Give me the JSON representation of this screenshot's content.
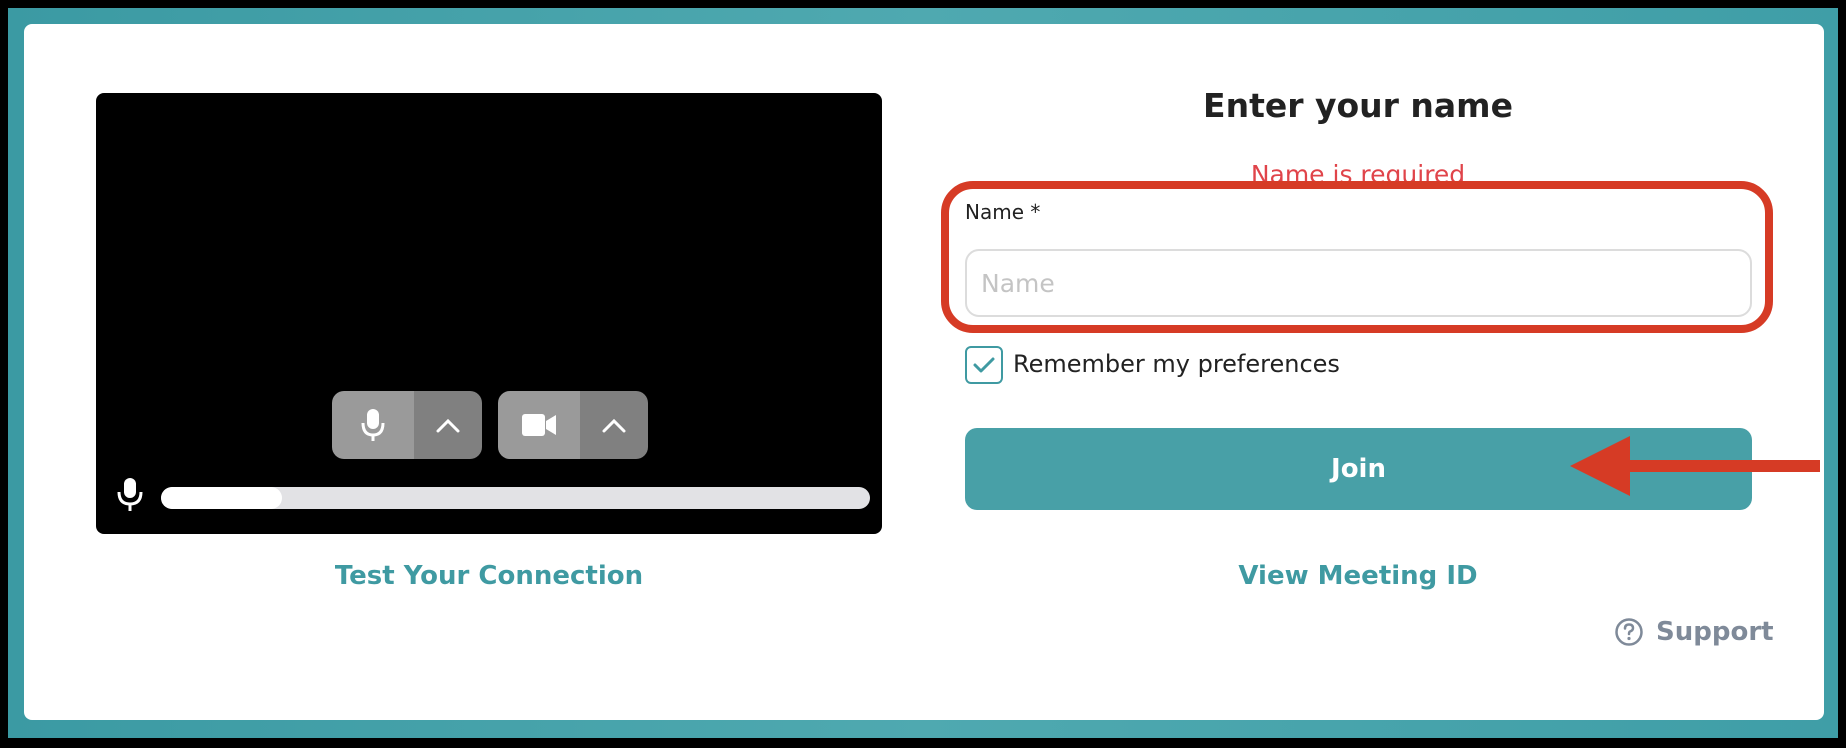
{
  "preview": {
    "mic_button": {
      "icon": "microphone-icon",
      "menu_icon": "chevron-up-icon"
    },
    "camera_button": {
      "icon": "video-camera-icon",
      "menu_icon": "chevron-up-icon"
    },
    "audio_level": 0.17,
    "test_connection_label": "Test Your Connection"
  },
  "form": {
    "heading": "Enter your name",
    "error_text": "Name is required",
    "name_label": "Name *",
    "name_placeholder": "Name",
    "name_value": "",
    "remember_label": "Remember my preferences",
    "remember_checked": true,
    "join_label": "Join",
    "meeting_id_label": "View Meeting ID"
  },
  "support": {
    "label": "Support",
    "icon": "help-circle-icon"
  },
  "colors": {
    "accent": "#48a0a7",
    "link": "#3f9aa2",
    "error": "#e0444a",
    "annotation": "#d63b25",
    "support": "#7f8a99"
  }
}
